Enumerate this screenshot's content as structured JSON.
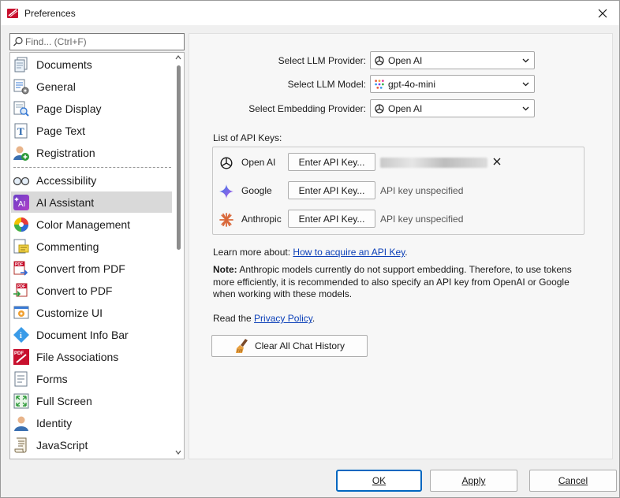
{
  "window": {
    "title": "Preferences"
  },
  "search": {
    "placeholder": "Find... (Ctrl+F)"
  },
  "sidebar": {
    "items": [
      {
        "label": "Documents",
        "icon": "documents-icon"
      },
      {
        "label": "General",
        "icon": "general-icon"
      },
      {
        "label": "Page Display",
        "icon": "page-display-icon"
      },
      {
        "label": "Page Text",
        "icon": "page-text-icon"
      },
      {
        "label": "Registration",
        "icon": "registration-icon"
      },
      {
        "label": "Accessibility",
        "icon": "accessibility-icon"
      },
      {
        "label": "AI Assistant",
        "icon": "ai-assistant-icon",
        "selected": true
      },
      {
        "label": "Color Management",
        "icon": "color-management-icon"
      },
      {
        "label": "Commenting",
        "icon": "commenting-icon"
      },
      {
        "label": "Convert from PDF",
        "icon": "convert-from-pdf-icon"
      },
      {
        "label": "Convert to PDF",
        "icon": "convert-to-pdf-icon"
      },
      {
        "label": "Customize UI",
        "icon": "customize-ui-icon"
      },
      {
        "label": "Document Info Bar",
        "icon": "document-info-bar-icon"
      },
      {
        "label": "File Associations",
        "icon": "file-associations-icon"
      },
      {
        "label": "Forms",
        "icon": "forms-icon"
      },
      {
        "label": "Full Screen",
        "icon": "full-screen-icon"
      },
      {
        "label": "Identity",
        "icon": "identity-icon"
      },
      {
        "label": "JavaScript",
        "icon": "javascript-icon"
      }
    ]
  },
  "ai": {
    "llm_provider_label": "Select LLM Provider:",
    "llm_provider_value": "Open AI",
    "llm_model_label": "Select LLM Model:",
    "llm_model_value": "gpt-4o-mini",
    "embedding_label": "Select Embedding Provider:",
    "embedding_value": "Open AI",
    "keys_label": "List of API Keys:",
    "keys": [
      {
        "provider": "Open AI",
        "button": "Enter API Key...",
        "status": ""
      },
      {
        "provider": "Google",
        "button": "Enter API Key...",
        "status": "API key unspecified"
      },
      {
        "provider": "Anthropic",
        "button": "Enter API Key...",
        "status": "API key unspecified"
      }
    ],
    "learn_prefix": "Learn more about: ",
    "learn_link": "How to acquire an API Key",
    "learn_suffix": ".",
    "note_bold": "Note:",
    "note_text": " Anthropic models currently do not support embedding. Therefore, to use tokens more efficiently, it is recommended to also specify an API key from OpenAI or Google when working with these models.",
    "privacy_prefix": "Read the ",
    "privacy_link": "Privacy Policy",
    "privacy_suffix": ".",
    "clear_button": "Clear All Chat History"
  },
  "footer": {
    "ok": "OK",
    "apply": "Apply",
    "cancel": "Cancel"
  },
  "colors": {
    "selected_bg": "#d9d9d9",
    "link": "#0b3fb8",
    "focus": "#0067c0"
  }
}
